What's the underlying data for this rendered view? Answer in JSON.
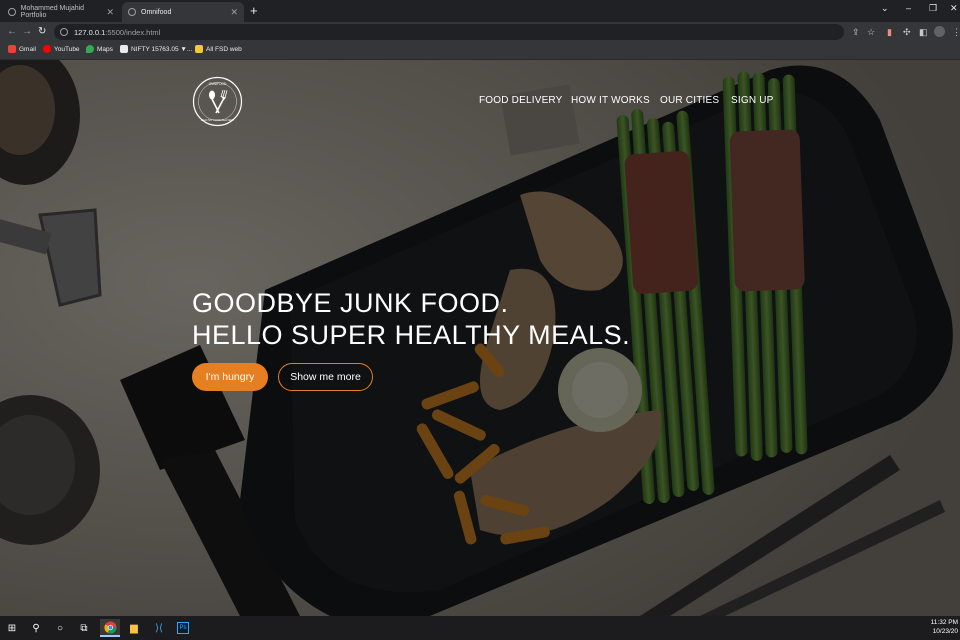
{
  "browser": {
    "tabs": [
      {
        "title": "Mohammed Mujahid Portfolio",
        "active": false
      },
      {
        "title": "Omnifood",
        "active": true
      }
    ],
    "new_tab": "+",
    "url_host": "127.0.0.1",
    "url_path": ":5500/index.html",
    "window_controls": {
      "chevron": "⌄",
      "minimize": "–",
      "restore": "❐",
      "close": "✕"
    },
    "bookmarks": [
      {
        "label": "Gmail",
        "icon": "gmail-icon",
        "color": "#ea4335"
      },
      {
        "label": "YouTube",
        "icon": "youtube-icon",
        "color": "#ff0000"
      },
      {
        "label": "Maps",
        "icon": "maps-icon",
        "color": "#34a853"
      },
      {
        "label": "NIFTY 15763.05 ▼...",
        "icon": "tradingview-icon",
        "color": "#e8eaed"
      },
      {
        "label": "All FSD web",
        "icon": "folder-icon",
        "color": "#f6c343"
      }
    ]
  },
  "site": {
    "logo_text_top": "OMNIFOOD",
    "logo_text_bottom": "HEALTHY FOOD DELIVERY",
    "nav": [
      "FOOD DELIVERY",
      "HOW IT WORKS",
      "OUR CITIES",
      "SIGN UP"
    ],
    "headline_line1": "GOODBYE JUNK FOOD.",
    "headline_line2": "HELLO SUPER HEALTHY MEALS.",
    "btn_primary": "I'm hungry",
    "btn_secondary": "Show me more",
    "accent_color": "#e67e22"
  },
  "taskbar": {
    "icons": [
      "windows-icon",
      "search-icon",
      "cortana-icon",
      "task-view-icon",
      "chrome-icon",
      "file-explorer-icon",
      "vscode-icon",
      "photoshop-icon"
    ],
    "time": "11:32 PM",
    "date": "10/23/20"
  }
}
